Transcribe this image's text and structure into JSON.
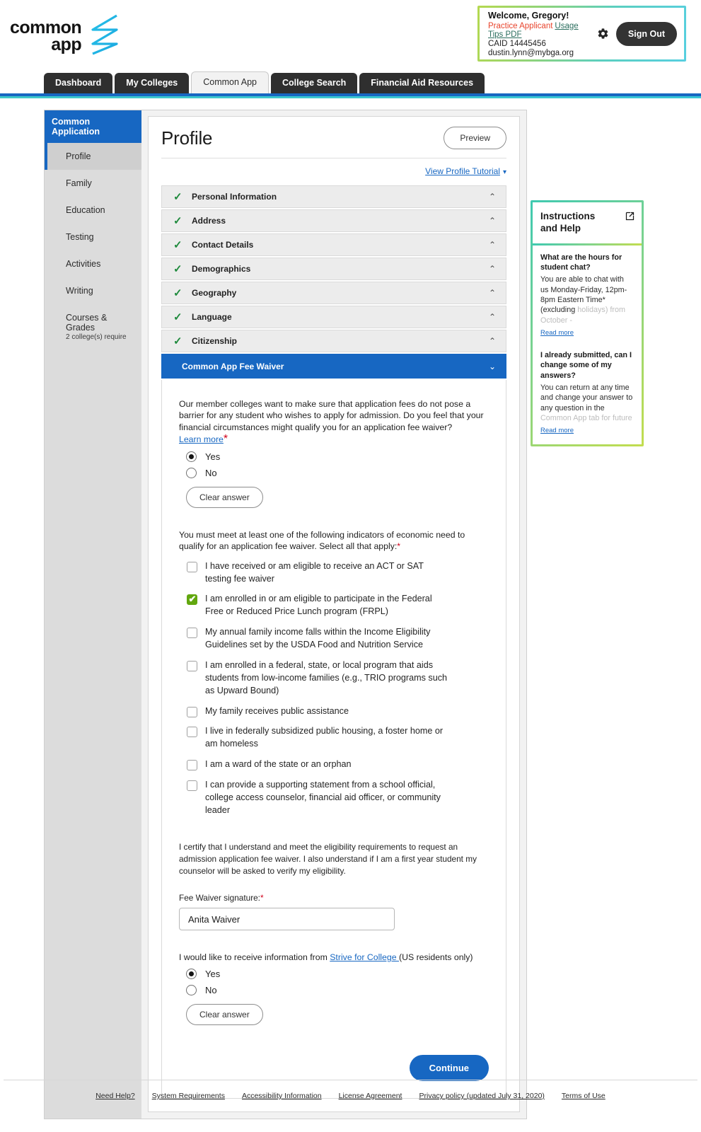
{
  "brand": {
    "logo_line1": "common",
    "logo_line2": "app",
    "accent_blue": "#1767c2",
    "accent_green": "#62a70f",
    "accent_red": "#d0021b"
  },
  "header": {
    "welcome_title": "Welcome, Gregory!",
    "practice_applicant": "Practice Applicant",
    "usage_tips": "Usage Tips PDF",
    "caid": "CAID 14445456",
    "email": "dustin.lynn@mybga.org",
    "gear_icon": "gear-icon",
    "sign_out": "Sign Out"
  },
  "tabs": [
    {
      "label": "Dashboard",
      "active": false
    },
    {
      "label": "My Colleges",
      "active": false
    },
    {
      "label": "Common App",
      "active": true
    },
    {
      "label": "College Search",
      "active": false
    },
    {
      "label": "Financial Aid Resources",
      "active": false
    }
  ],
  "sidebar": {
    "title": "Common Application",
    "items": [
      {
        "label": "Profile",
        "sub": "",
        "active": true
      },
      {
        "label": "Family",
        "sub": "",
        "active": false
      },
      {
        "label": "Education",
        "sub": "",
        "active": false
      },
      {
        "label": "Testing",
        "sub": "",
        "active": false
      },
      {
        "label": "Activities",
        "sub": "",
        "active": false
      },
      {
        "label": "Writing",
        "sub": "",
        "active": false
      },
      {
        "label": "Courses & Grades",
        "sub": "2 college(s) require",
        "active": false
      }
    ]
  },
  "main": {
    "page_title": "Profile",
    "preview_label": "Preview",
    "tutorial_label": "View Profile Tutorial",
    "sections": [
      {
        "label": "Personal Information",
        "complete": true,
        "open": false
      },
      {
        "label": "Address",
        "complete": true,
        "open": false
      },
      {
        "label": "Contact Details",
        "complete": true,
        "open": false
      },
      {
        "label": "Demographics",
        "complete": true,
        "open": false
      },
      {
        "label": "Geography",
        "complete": true,
        "open": false
      },
      {
        "label": "Language",
        "complete": true,
        "open": false
      },
      {
        "label": "Citizenship",
        "complete": true,
        "open": false
      },
      {
        "label": "Common App Fee Waiver",
        "complete": false,
        "open": true
      }
    ],
    "fee_waiver": {
      "intro": "Our member colleges want to make sure that application fees do not pose a barrier for any student who wishes to apply for admission. Do you feel that your financial circumstances might qualify you for an application fee waiver?",
      "learn_more": "Learn more",
      "required_mark": "*",
      "radio_yes": "Yes",
      "radio_no": "No",
      "selected": "Yes",
      "clear_answer": "Clear answer",
      "indicators_prompt": "You must meet at least one of the following indicators of economic need to qualify for an application fee waiver. Select all that apply:",
      "indicators": [
        {
          "label": "I have received or am eligible to receive an ACT or SAT testing fee waiver",
          "checked": false
        },
        {
          "label": "I am enrolled in or am eligible to participate in the Federal Free or Reduced Price Lunch program (FRPL)",
          "checked": true
        },
        {
          "label": "My annual family income falls within the Income Eligibility Guidelines set by the USDA Food and Nutrition Service",
          "checked": false
        },
        {
          "label": "I am enrolled in a federal, state, or local program that aids students from low-income families (e.g., TRIO programs such as Upward Bound)",
          "checked": false
        },
        {
          "label": "My family receives public assistance",
          "checked": false
        },
        {
          "label": "I live in federally subsidized public housing, a foster home or am homeless",
          "checked": false
        },
        {
          "label": "I am a ward of the state or an orphan",
          "checked": false
        },
        {
          "label": "I can provide a supporting statement from a school official, college access counselor, financial aid officer, or community leader",
          "checked": false
        }
      ],
      "certification": "I certify that I understand and meet the eligibility requirements to request an admission application fee waiver. I also understand if I am a first year student my counselor will be asked to verify my eligibility.",
      "signature_label": "Fee Waiver signature:",
      "signature_value": "Anita Waiver",
      "signature_placeholder": "",
      "strive_prefix": "I would like to receive information from ",
      "strive_link": "Strive for College ",
      "strive_suffix": "(US residents only)",
      "strive_yes": "Yes",
      "strive_no": "No",
      "strive_selected": "Yes",
      "strive_clear": "Clear answer",
      "continue_label": "Continue"
    }
  },
  "help": {
    "title_line1": "Instructions",
    "title_line2": "and Help",
    "external_icon": "external-link-icon",
    "faqs": [
      {
        "question": "What are the hours for student chat?",
        "answer": "You are able to chat with us Monday-Friday, 12pm-8pm Eastern Time* (excluding ",
        "answer_faded": "holidays) from October -",
        "read_more": "Read more"
      },
      {
        "question": "I already submitted, can I change some of my answers?",
        "answer": "You can return at any time and change your answer to any question in the ",
        "answer_faded": "Common App tab for future",
        "read_more": "Read more"
      }
    ]
  },
  "footer": {
    "links": [
      "Need Help?",
      "System Requirements",
      "Accessibility Information",
      "License Agreement",
      "Privacy policy (updated July 31, 2020)",
      "Terms of Use"
    ]
  }
}
